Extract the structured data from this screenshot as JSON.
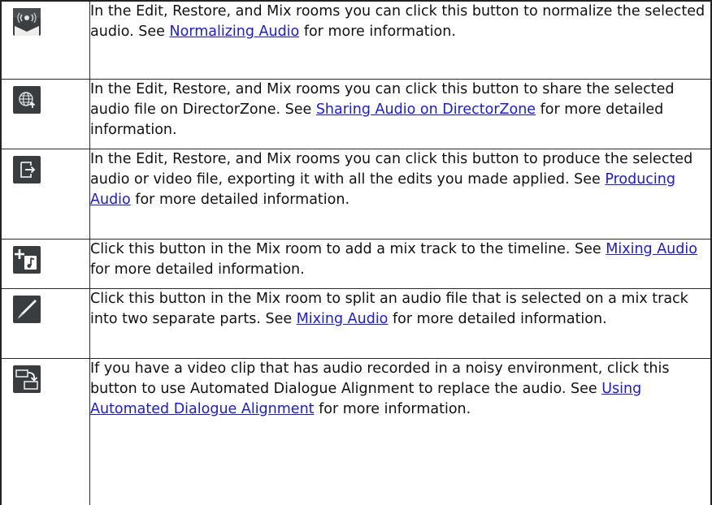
{
  "rows": [
    {
      "icon": "normalize-audio-icon",
      "text_before": "In the Edit, Restore, and Mix rooms you can click this button to normalize the selected audio. See ",
      "link": "Normalizing Audio",
      "text_after": " for more information."
    },
    {
      "icon": "share-directorzone-icon",
      "text_before": "In the Edit, Restore, and Mix rooms you can click this button to share the selected audio file on DirectorZone. See ",
      "link": "Sharing Audio on DirectorZone",
      "text_after": " for more detailed information."
    },
    {
      "icon": "produce-export-icon",
      "text_before": "In the Edit, Restore, and Mix rooms you can click this button to produce the selected audio or video file, exporting it with all the edits you made applied. See ",
      "link": "Producing Audio",
      "text_after": " for more detailed information."
    },
    {
      "icon": "add-mix-track-icon",
      "text_before": "Click this button in the Mix room to add a mix track to the timeline. See ",
      "link": "Mixing Audio",
      "text_after": " for more detailed information."
    },
    {
      "icon": "split-audio-icon",
      "text_before": "Click this button in the Mix room to split an audio file that is selected on a mix track into two separate parts. See ",
      "link": "Mixing Audio",
      "text_after": " for more detailed information."
    },
    {
      "icon": "dialogue-alignment-icon",
      "text_before": "If you have a video clip that has audio recorded in a noisy environment, click this button to use Automated Dialogue Alignment to replace the audio. See ",
      "link": "Using Automated Dialogue Alignment",
      "text_after": " for more information."
    }
  ],
  "colors": {
    "link": "#1a1adb",
    "icon_bg": "#3a3d40",
    "border": "#2a2a2a"
  }
}
